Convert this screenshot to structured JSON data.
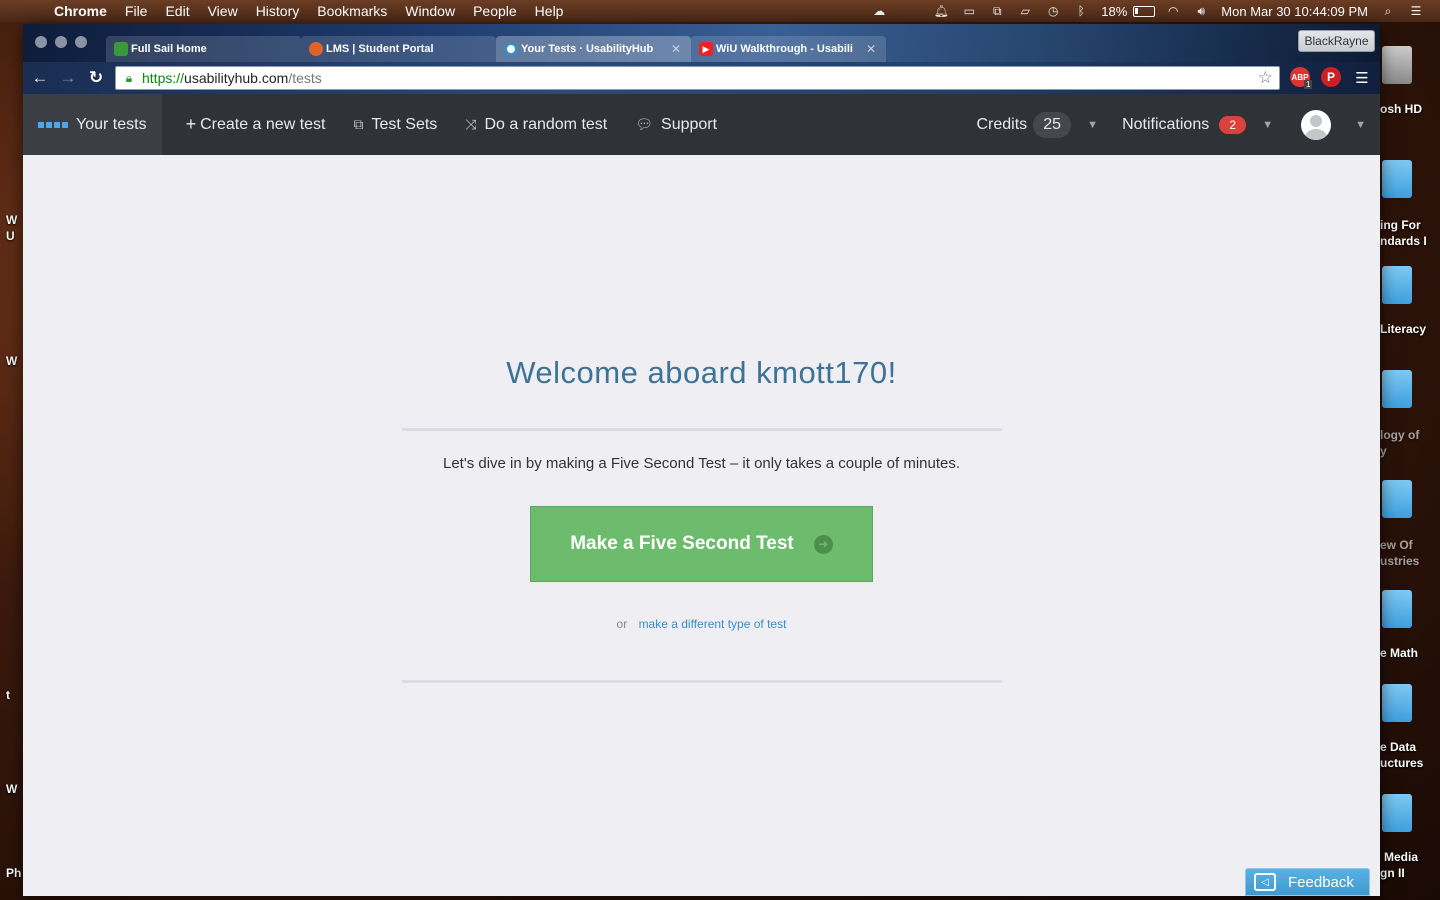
{
  "menubar": {
    "apple_glyph": "",
    "app_name": "Chrome",
    "menus": [
      "File",
      "Edit",
      "View",
      "History",
      "Bookmarks",
      "Window",
      "People",
      "Help"
    ],
    "battery": "18%",
    "datetime": "Mon Mar 30  10:44:09 PM"
  },
  "desktop": {
    "right_labels": [
      "osh HD",
      "ing For",
      "ndards I",
      "Literacy",
      "logy of",
      "y",
      "ew Of",
      "ustries",
      "e Math",
      "e Data",
      "uctures",
      "Media",
      "gn II"
    ],
    "left_labels": [
      "W",
      "U",
      "W",
      "t",
      "W",
      "Ph"
    ]
  },
  "browser": {
    "profile_name": "BlackRayne",
    "tabs": [
      {
        "title": "Full Sail Home",
        "active": false
      },
      {
        "title": "LMS | Student Portal",
        "active": false
      },
      {
        "title": "Your Tests · UsabilityHub",
        "active": true
      },
      {
        "title": "WiU Walkthrough - Usabili",
        "active": false
      }
    ],
    "url": {
      "scheme": "https://",
      "host": "usabilityhub.com",
      "path": "/tests"
    },
    "ext_abp": "ABP",
    "ext_abp_badge": "1"
  },
  "nav": {
    "your_tests": "Your tests",
    "create": "Create a new test",
    "test_sets": "Test Sets",
    "random": "Do a random test",
    "support": "Support",
    "credits_label": "Credits",
    "credits_value": "25",
    "notifications_label": "Notifications",
    "notifications_count": "2"
  },
  "main": {
    "welcome": "Welcome aboard kmott170!",
    "intro": "Let's dive in by making a Five Second Test – it only takes a couple of minutes.",
    "cta": "Make a Five Second Test",
    "or": "or",
    "alt_link": "make a different type of test"
  },
  "feedback": "Feedback",
  "colors": {
    "nav_bg": "#2f3237",
    "welcome_text": "#3d7396",
    "cta_green": "#6dbb6d",
    "link_blue": "#3a8bc7",
    "badge_red": "#d9433c",
    "feedback_blue": "#4aa5d9"
  }
}
